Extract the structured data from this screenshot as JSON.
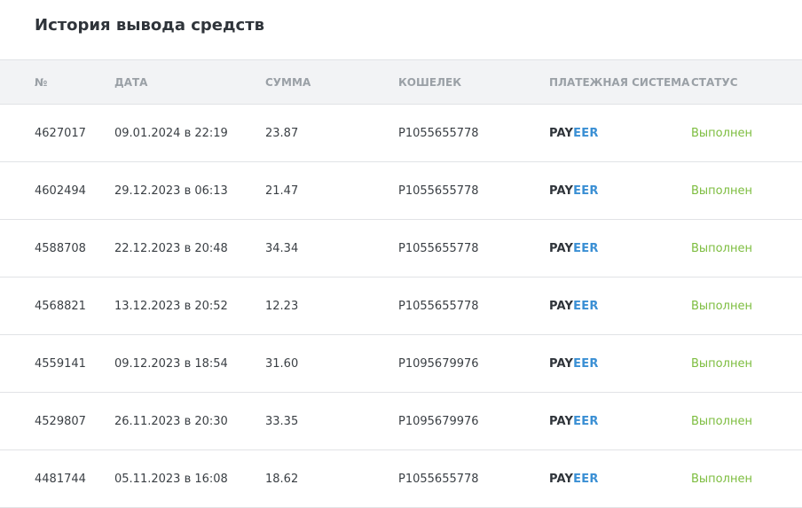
{
  "title": "История вывода средств",
  "columns": {
    "number": "№",
    "date": "ДАТА",
    "amount": "СУММА",
    "wallet": "КОШЕЛЕК",
    "payment_system": "ПЛАТЕЖНАЯ СИСТЕМА",
    "status": "СТАТУС"
  },
  "payment_logo": {
    "part1": "PAY",
    "part2": "EER",
    "part1_color": "#2f343a",
    "part2_color": "#3a8fd4"
  },
  "status_color": "#7dbd3f",
  "rows": [
    {
      "number": "4627017",
      "date": "09.01.2024 в 22:19",
      "amount": "23.87",
      "wallet": "P1055655778",
      "status": "Выполнен"
    },
    {
      "number": "4602494",
      "date": "29.12.2023 в 06:13",
      "amount": "21.47",
      "wallet": "P1055655778",
      "status": "Выполнен"
    },
    {
      "number": "4588708",
      "date": "22.12.2023 в 20:48",
      "amount": "34.34",
      "wallet": "P1055655778",
      "status": "Выполнен"
    },
    {
      "number": "4568821",
      "date": "13.12.2023 в 20:52",
      "amount": "12.23",
      "wallet": "P1055655778",
      "status": "Выполнен"
    },
    {
      "number": "4559141",
      "date": "09.12.2023 в 18:54",
      "amount": "31.60",
      "wallet": "P1095679976",
      "status": "Выполнен"
    },
    {
      "number": "4529807",
      "date": "26.11.2023 в 20:30",
      "amount": "33.35",
      "wallet": "P1095679976",
      "status": "Выполнен"
    },
    {
      "number": "4481744",
      "date": "05.11.2023 в 16:08",
      "amount": "18.62",
      "wallet": "P1055655778",
      "status": "Выполнен"
    }
  ]
}
